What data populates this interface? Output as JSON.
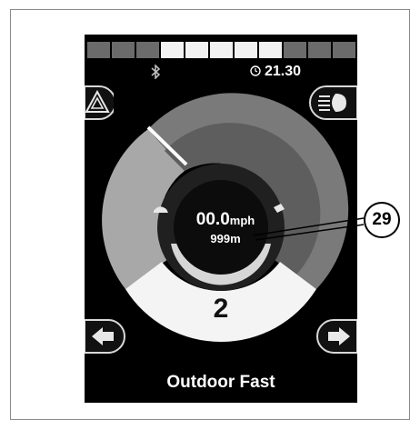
{
  "status": {
    "time": "21.30",
    "battery_segments": [
      {
        "state": "dark"
      },
      {
        "state": "dark"
      },
      {
        "state": "dark"
      },
      {
        "state": "light"
      },
      {
        "state": "light"
      },
      {
        "state": "light"
      },
      {
        "state": "light"
      },
      {
        "state": "light"
      },
      {
        "state": "dark"
      },
      {
        "state": "dark"
      },
      {
        "state": "dark"
      }
    ]
  },
  "icons": {
    "hazard": "hazard-warning-icon",
    "lights": "headlights-icon",
    "bluetooth": "bluetooth-icon",
    "clock": "clock-icon",
    "left": "left-indicator-arrow-icon",
    "right": "right-indicator-arrow-icon"
  },
  "drive": {
    "speed_value": "00.0",
    "speed_unit": "mph",
    "distance": "999m",
    "speed_setting": "2",
    "profile": "Outdoor Fast"
  },
  "callout": {
    "number": "29"
  },
  "colors": {
    "screen_bg": "#000000",
    "segment_dark": "#6b6b6b",
    "segment_light": "#f2f2f2"
  }
}
